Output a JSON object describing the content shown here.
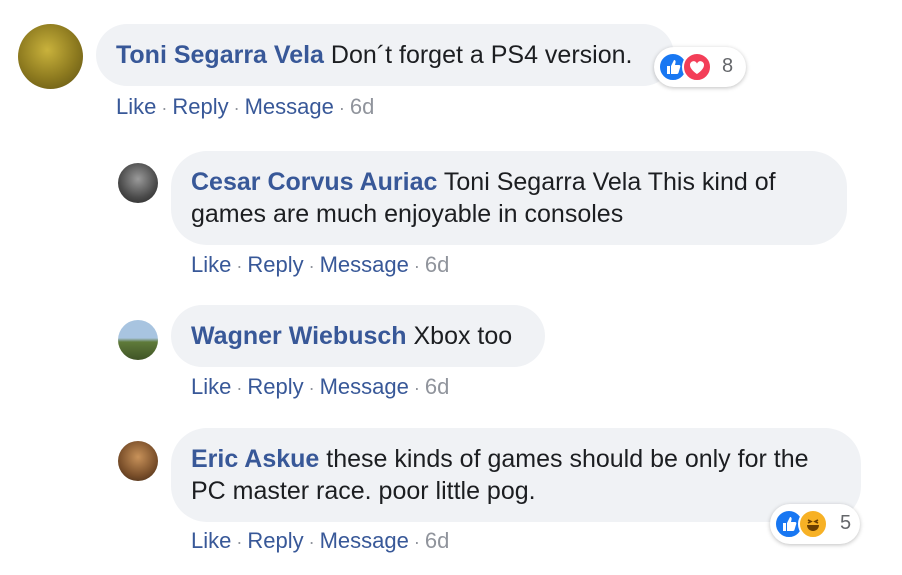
{
  "actions": {
    "like": "Like",
    "reply": "Reply",
    "message": "Message",
    "sep": "·"
  },
  "comments": [
    {
      "author": "Toni Segarra Vela",
      "text": "Don´t forget a PS4 version.",
      "time": "6d",
      "reactions": {
        "icons": [
          "like-icon",
          "love-icon"
        ],
        "count": "8"
      }
    },
    {
      "author": "Cesar Corvus Auriac",
      "text": "Toni Segarra Vela This kind of games are much enjoyable in consoles",
      "time": "6d"
    },
    {
      "author": "Wagner Wiebusch",
      "text": "Xbox too",
      "time": "6d"
    },
    {
      "author": "Eric Askue",
      "text": "these kinds of games should be only for the PC master race. poor little pog.",
      "time": "6d",
      "reactions": {
        "icons": [
          "like-icon",
          "haha-icon"
        ],
        "count": "5"
      }
    }
  ],
  "colors": {
    "link": "#385898",
    "bubble": "#f0f2f5",
    "like": "#1877f2",
    "love": "#f33e58",
    "haha": "#f7b125"
  }
}
